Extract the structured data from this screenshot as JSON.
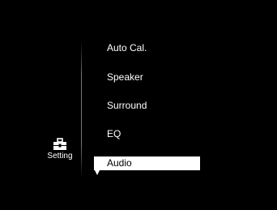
{
  "category": {
    "icon": "toolbox-icon",
    "label": "Setting"
  },
  "menu": {
    "items": [
      {
        "label": "Auto Cal.",
        "selected": false
      },
      {
        "label": "Speaker",
        "selected": false
      },
      {
        "label": "Surround",
        "selected": false
      },
      {
        "label": "EQ",
        "selected": false
      },
      {
        "label": "Audio",
        "selected": true
      }
    ],
    "more_indicator": "down-arrow-icon"
  },
  "colors": {
    "background": "#000000",
    "text": "#ffffff",
    "highlight_bg": "#ffffff",
    "highlight_text": "#000000"
  }
}
